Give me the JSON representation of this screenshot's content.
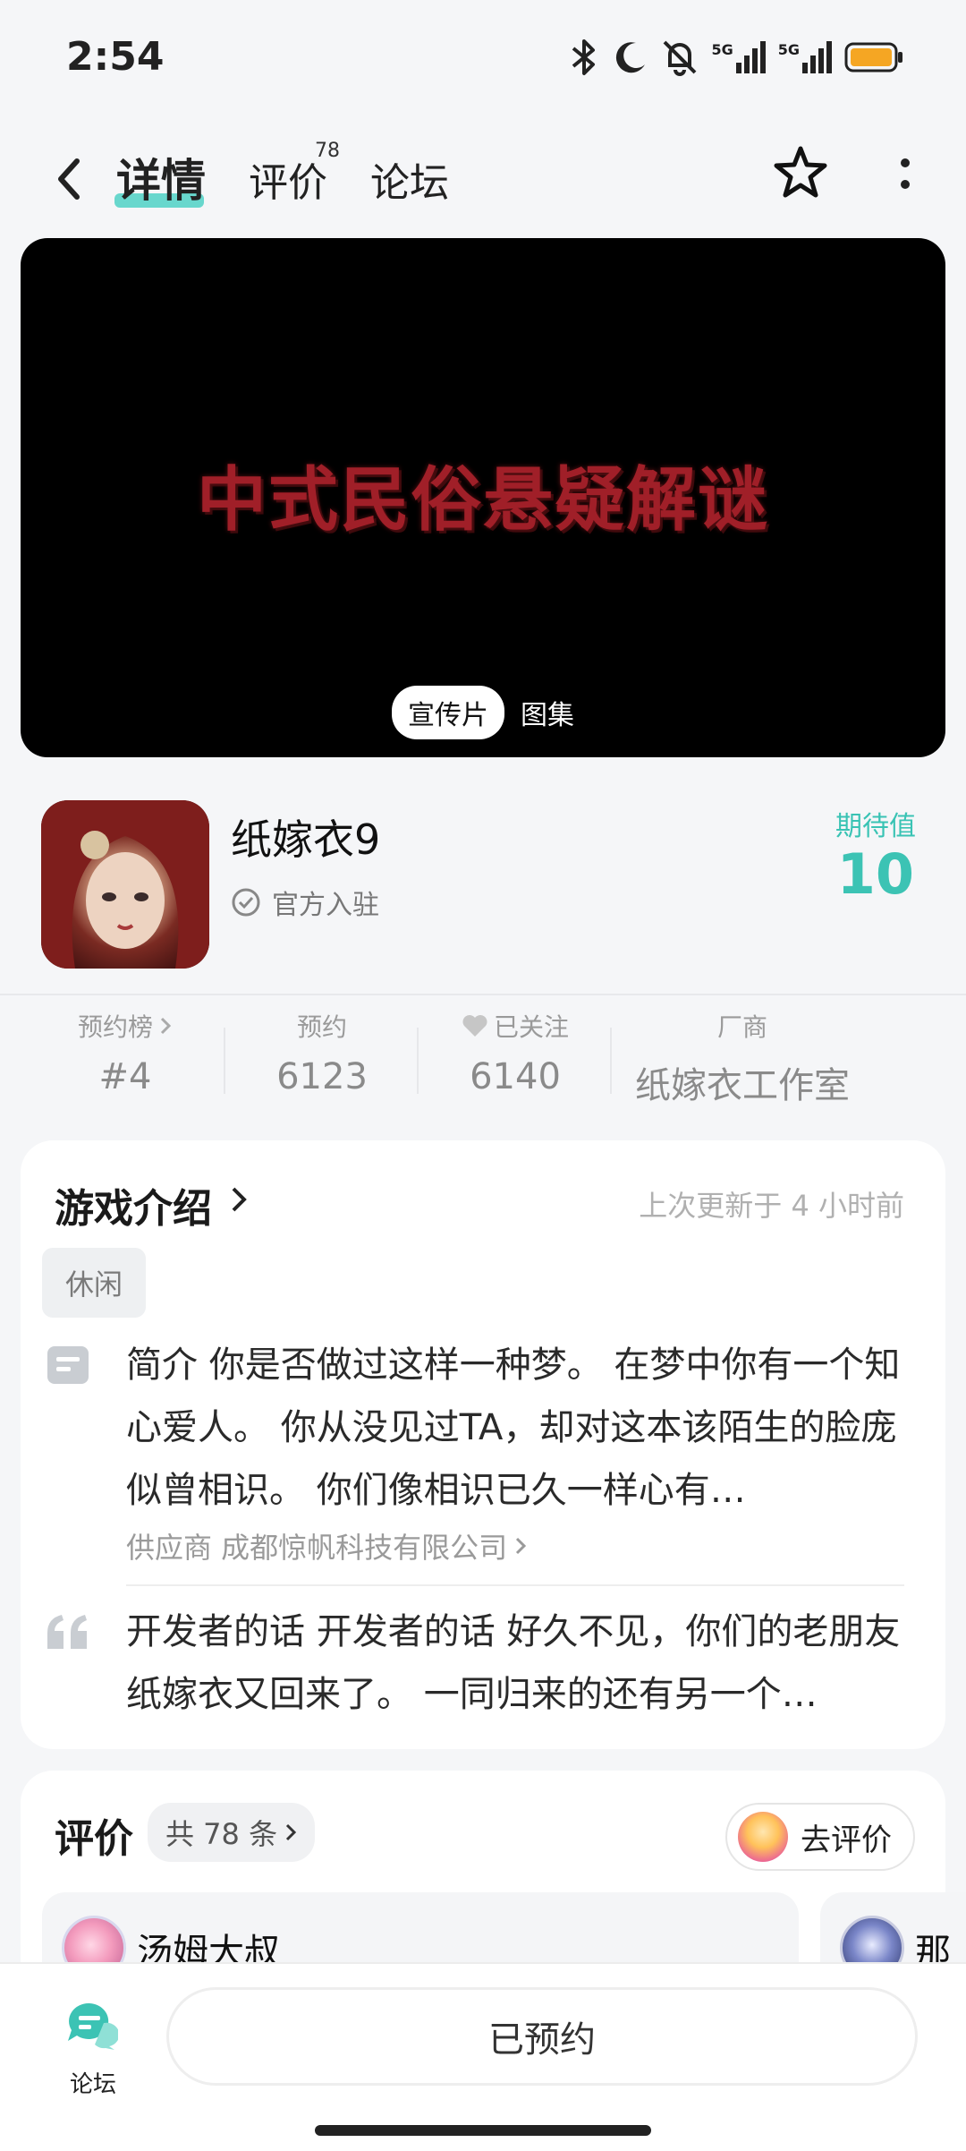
{
  "status_bar": {
    "time": "2:54",
    "network_1": "5G",
    "network_2": "5G"
  },
  "nav": {
    "tabs": [
      {
        "label": "详情",
        "active": true
      },
      {
        "label": "评价",
        "badge": "78"
      },
      {
        "label": "论坛"
      }
    ]
  },
  "video": {
    "title": "中式民俗悬疑解谜",
    "media_tabs": [
      "宣传片",
      "图集"
    ]
  },
  "game": {
    "name": "纸嫁衣9",
    "official": "官方入驻",
    "expectation_label": "期待值",
    "expectation_value": "10"
  },
  "stats": [
    {
      "label": "预约榜",
      "value": "#4"
    },
    {
      "label": "预约",
      "value": "6123"
    },
    {
      "label": "已关注",
      "value": "6140"
    },
    {
      "label": "厂商",
      "value": "纸嫁衣工作室"
    }
  ],
  "intro": {
    "heading": "游戏介绍",
    "updated": "上次更新于 4 小时前",
    "tag": "休闲",
    "description": "简介 你是否做过这样一种梦。 在梦中你有一个知心爱人。 你从没见过TA，却对这本该陌生的脸庞似曾相识。 你们像相识已久一样心有…",
    "supplier": "供应商 成都惊帆科技有限公司",
    "developer_words": "开发者的话 开发者的话 好久不见，你们的老朋友纸嫁衣又回来了。 一同归来的还有另一个…"
  },
  "reviews": {
    "heading": "评价",
    "count": "共 78 条",
    "go_review": "去评价",
    "items": [
      {
        "name": "汤姆大叔"
      },
      {
        "name": "那"
      }
    ]
  },
  "bottom": {
    "forum_label": "论坛",
    "reserve_button": "已预约"
  },
  "colors": {
    "accent": "#3cc3b4",
    "title_red": "#a01f28"
  }
}
